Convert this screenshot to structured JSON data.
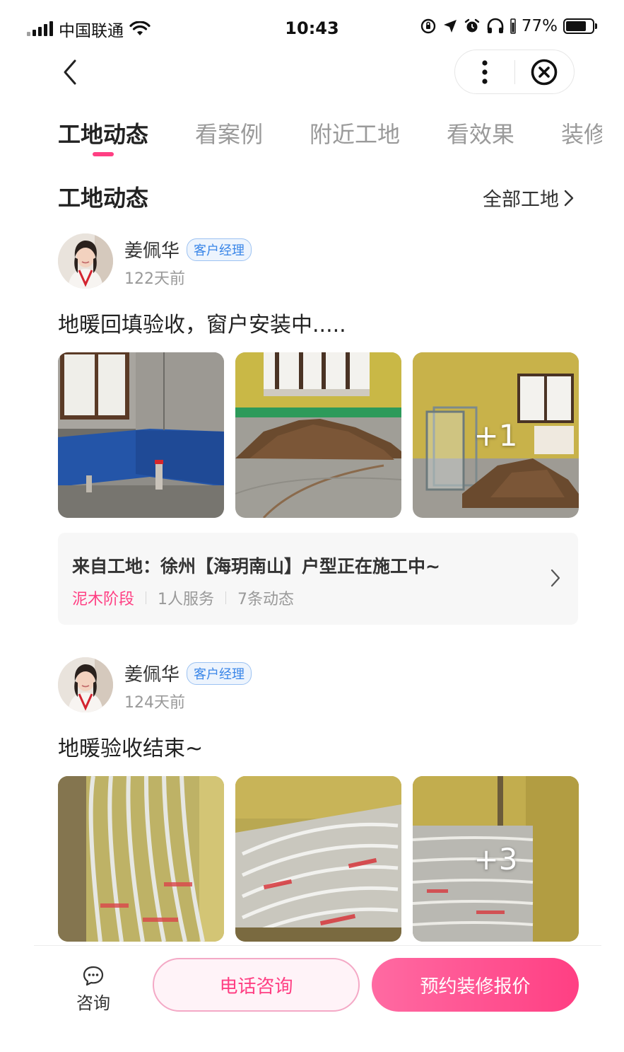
{
  "status_bar": {
    "carrier": "中国联通",
    "time": "10:43",
    "battery": "77%"
  },
  "tabs": [
    {
      "label": "工地动态",
      "active": true
    },
    {
      "label": "看案例",
      "active": false
    },
    {
      "label": "附近工地",
      "active": false
    },
    {
      "label": "看效果",
      "active": false
    },
    {
      "label": "装修",
      "active": false
    }
  ],
  "section": {
    "title": "工地动态",
    "all_link": "全部工地"
  },
  "posts": [
    {
      "author": "姜佩华",
      "role": "客户经理",
      "time": "122天前",
      "content": "地暖回填验收，窗户安装中.....",
      "extra_count": "+1",
      "site": {
        "title": "来自工地：徐州【海玥南山】户型正在施工中~",
        "stage": "泥木阶段",
        "service": "1人服务",
        "updates": "7条动态"
      }
    },
    {
      "author": "姜佩华",
      "role": "客户经理",
      "time": "124天前",
      "content": "地暖验收结束~",
      "extra_count": "+3"
    }
  ],
  "bottom_bar": {
    "consult_label": "咨询",
    "phone_label": "电话咨询",
    "quote_label": "预约装修报价"
  },
  "colors": {
    "accent": "#ff3f83",
    "badge_blue": "#3a86e8"
  }
}
